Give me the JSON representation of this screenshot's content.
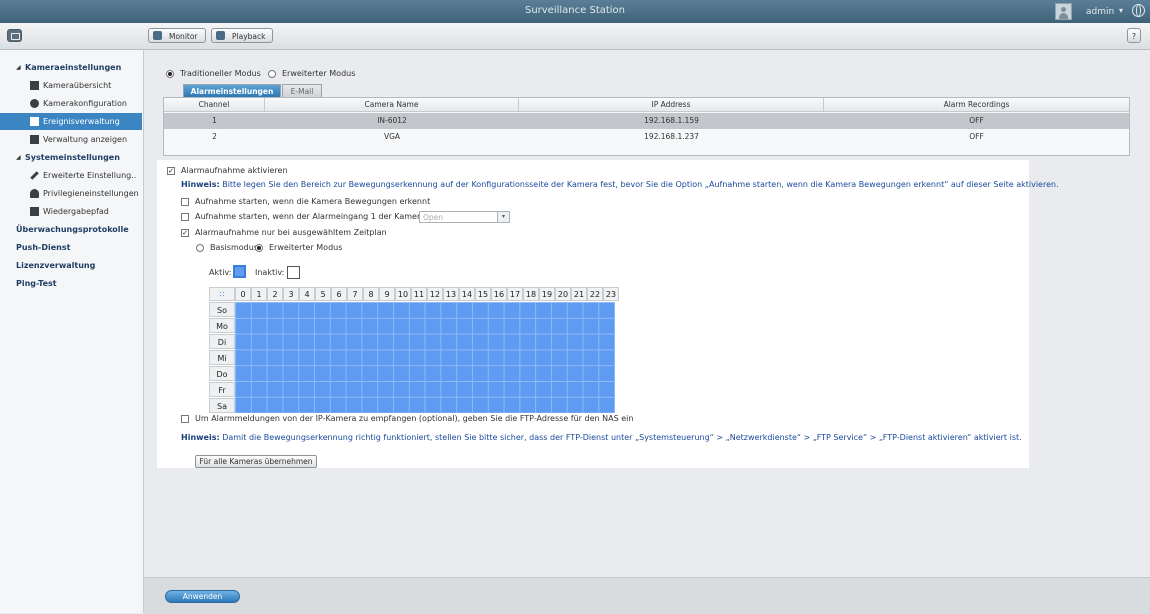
{
  "titlebar": {
    "title": "Surveillance Station",
    "user": "admin",
    "caret": "▾"
  },
  "toolbar": {
    "monitor_label": "Monitor",
    "playback_label": "Playback",
    "help_label": "?"
  },
  "sidebar": {
    "items": [
      {
        "label": "Kameraeinstellungen",
        "group": true,
        "caret": "◢"
      },
      {
        "label": "Kameraübersicht"
      },
      {
        "label": "Kamerakonfiguration"
      },
      {
        "label": "Ereignisverwaltung",
        "active": true
      },
      {
        "label": "Verwaltung anzeigen"
      },
      {
        "label": "Systemeinstellungen",
        "group": true,
        "caret": "◢"
      },
      {
        "label": "Erweiterte Einstellung.."
      },
      {
        "label": "Privilegieneinstellungen"
      },
      {
        "label": "Wiedergabepfad"
      },
      {
        "label": "Überwachungsprotokolle",
        "group": true
      },
      {
        "label": "Push-Dienst",
        "group": true
      },
      {
        "label": "Lizenzverwaltung",
        "group": true
      },
      {
        "label": "Ping-Test",
        "group": true
      }
    ]
  },
  "mode": {
    "traditional": "Traditioneller Modus",
    "extended": "Erweiterter Modus"
  },
  "tabs": {
    "alarm": "Alarmeinstellungen",
    "email": "E-Mail"
  },
  "table": {
    "headers": [
      "Channel",
      "Camera Name",
      "IP Address",
      "Alarm Recordings"
    ],
    "rows": [
      [
        "1",
        "IN-6012",
        "192.168.1.159",
        "OFF"
      ],
      [
        "2",
        "VGA",
        "192.168.1.237",
        "OFF"
      ]
    ]
  },
  "alarm": {
    "enable_label": "Alarmaufnahme aktivieren",
    "hint1_label": "Hinweis:",
    "hint1_text": "Bitte legen Sie den Bereich zur Bewegungserkennung auf der Konfigurationsseite der Kamera fest, bevor Sie die Option „Aufnahme starten, wenn die Kamera Bewegungen erkennt“ auf dieser Seite aktivieren.",
    "motion_label": "Aufnahme starten, wenn die Kamera Bewegungen erkennt",
    "input_label": "Aufnahme starten, wenn der Alarmeingang 1 der Kamera",
    "input_select": "Open",
    "schedule_label": "Alarmaufnahme nur bei ausgewähltem Zeitplan",
    "basic_mode": "Basismodus",
    "advanced_mode": "Erweiterter Modus",
    "active_label": "Aktiv:",
    "inactive_label": "Inaktiv:",
    "ftp_label": "Um Alarmmeldungen von der IP-Kamera zu empfangen (optional), geben Sie die FTP-Adresse für den NAS ein",
    "hint2_label": "Hinweis:",
    "hint2_text": "Damit die Bewegungserkennung richtig funktioniert, stellen Sie bitte sicher, dass der FTP-Dienst unter „Systemsteuerung“ > „Netzwerkdienste“ > „FTP Service“ > „FTP-Dienst aktivieren“ aktiviert ist.",
    "apply_all": "Für alle Kameras übernehmen"
  },
  "schedule": {
    "hours": [
      "0",
      "1",
      "2",
      "3",
      "4",
      "5",
      "6",
      "7",
      "8",
      "9",
      "10",
      "11",
      "12",
      "13",
      "14",
      "15",
      "16",
      "17",
      "18",
      "19",
      "20",
      "21",
      "22",
      "23"
    ],
    "days": [
      "So",
      "Mo",
      "Di",
      "Mi",
      "Do",
      "Fr",
      "Sa"
    ],
    "active_color": "#5f9bf2"
  },
  "footer": {
    "apply": "Anwenden"
  }
}
